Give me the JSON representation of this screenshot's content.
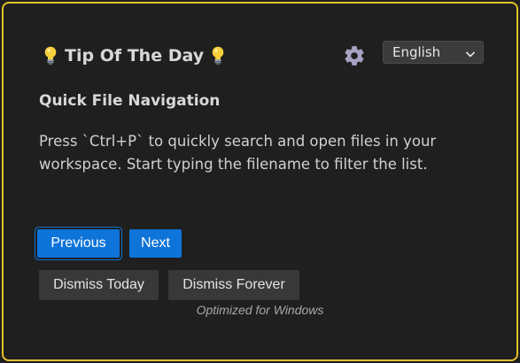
{
  "header": {
    "title": "Tip Of The Day",
    "settings_icon": "gear-icon",
    "language": {
      "selected": "English"
    }
  },
  "tip": {
    "title": "Quick File Navigation",
    "body": "Press `Ctrl+P` to quickly search and open files in your workspace. Start typing the filename to filter the list."
  },
  "actions": {
    "previous_label": "Previous",
    "next_label": "Next",
    "dismiss_today_label": "Dismiss Today",
    "dismiss_forever_label": "Dismiss Forever"
  },
  "footer": {
    "note": "Optimized for Windows"
  },
  "colors": {
    "border": "#e2c12e",
    "background": "#1f1f1f",
    "primary_button": "#0e74d9",
    "secondary_button": "#383838"
  }
}
